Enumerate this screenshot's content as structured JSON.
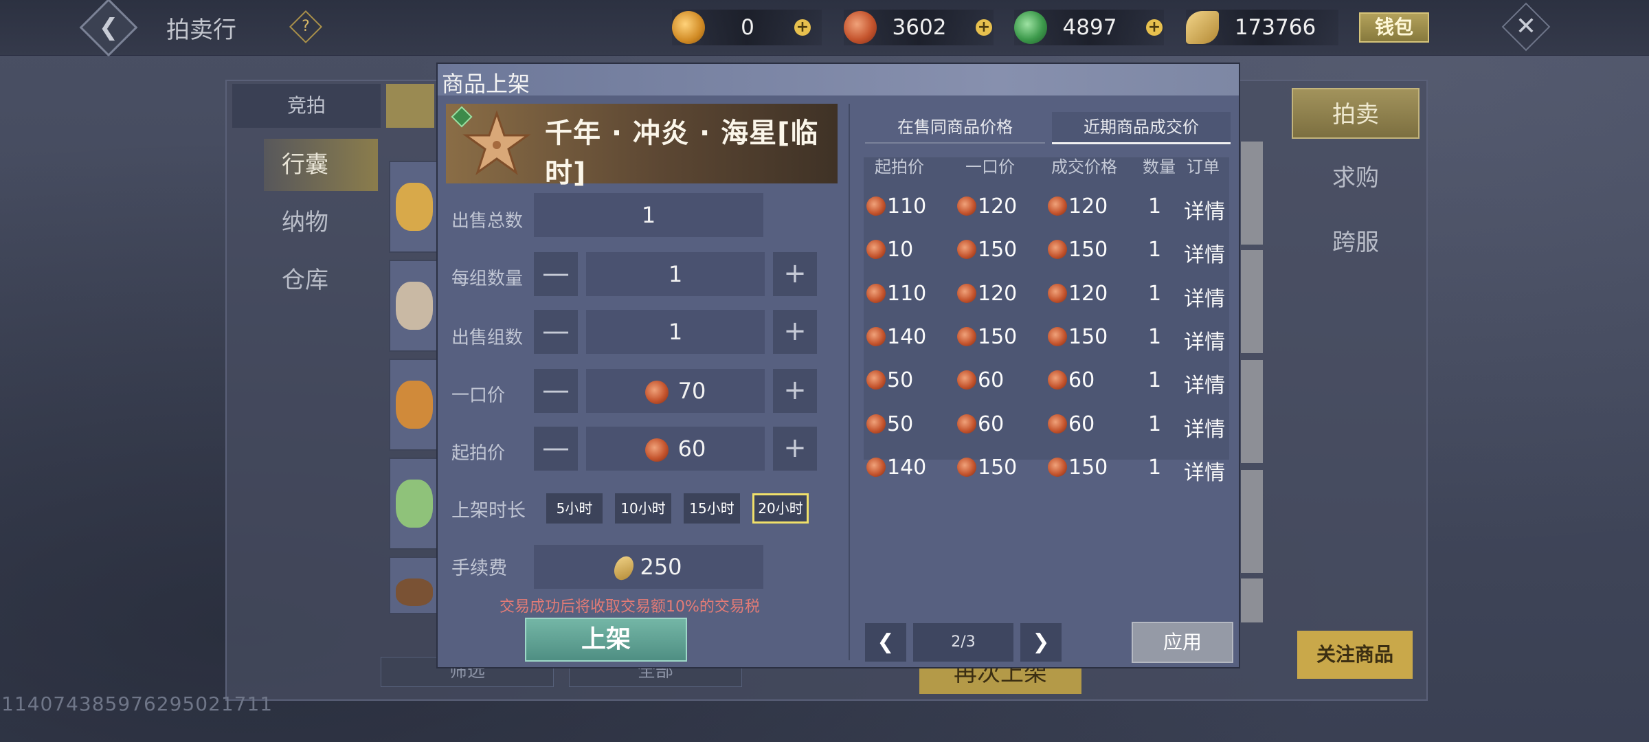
{
  "topbar": {
    "title": "拍卖行",
    "help_label": "?",
    "currencies": [
      {
        "name": "gold-ingot",
        "value": "0",
        "color": "#e8a93a"
      },
      {
        "name": "copper-coin",
        "value": "3602",
        "color": "#c5552e"
      },
      {
        "name": "jade-coin",
        "value": "4897",
        "color": "#3d9a4c"
      },
      {
        "name": "gold-leaf",
        "value": "173766",
        "color": "#c99a3f"
      }
    ],
    "wallet_label": "钱包"
  },
  "background": {
    "tabs": [
      "竞拍"
    ],
    "left_nav": [
      "行囊",
      "纳物",
      "仓库"
    ],
    "right_tabs": [
      "拍卖",
      "求购",
      "跨服"
    ],
    "follow_label": "关注商品",
    "relist_label": "再次上架",
    "filter_label": "筛选",
    "all_label": "全部"
  },
  "user_id": "1140743859762950217­11",
  "dialog": {
    "title": "商品上架",
    "item_name": "千年 · 冲炎 · 海星[临时]",
    "fields": {
      "total_label": "出售总数",
      "total_value": "1",
      "per_group_label": "每组数量",
      "per_group_value": "1",
      "groups_label": "出售组数",
      "groups_value": "1",
      "buyout_label": "一口价",
      "buyout_value": "70",
      "start_label": "起拍价",
      "start_value": "60",
      "duration_label": "上架时长",
      "durations": [
        "5小时",
        "10小时",
        "15小时",
        "20小时"
      ],
      "selected_duration": "20小时",
      "fee_label": "手续费",
      "fee_value": "250"
    },
    "tax_note": "交易成功后将收取交易额10%的交易税",
    "list_button": "上架",
    "price_tabs": [
      "在售同商品价格",
      "近期商品成交价"
    ],
    "active_price_tab": "近期商品成交价",
    "table_headers": [
      "起拍价",
      "一口价",
      "成交价格",
      "数量",
      "订单"
    ],
    "rows": [
      {
        "start": "110",
        "buyout": "120",
        "deal": "120",
        "qty": "1",
        "order": "详情"
      },
      {
        "start": "10",
        "buyout": "150",
        "deal": "150",
        "qty": "1",
        "order": "详情"
      },
      {
        "start": "110",
        "buyout": "120",
        "deal": "120",
        "qty": "1",
        "order": "详情"
      },
      {
        "start": "140",
        "buyout": "150",
        "deal": "150",
        "qty": "1",
        "order": "详情"
      },
      {
        "start": "50",
        "buyout": "60",
        "deal": "60",
        "qty": "1",
        "order": "详情"
      },
      {
        "start": "50",
        "buyout": "60",
        "deal": "60",
        "qty": "1",
        "order": "详情"
      },
      {
        "start": "140",
        "buyout": "150",
        "deal": "150",
        "qty": "1",
        "order": "详情"
      }
    ],
    "page_label": "2/3",
    "apply_label": "应用"
  }
}
